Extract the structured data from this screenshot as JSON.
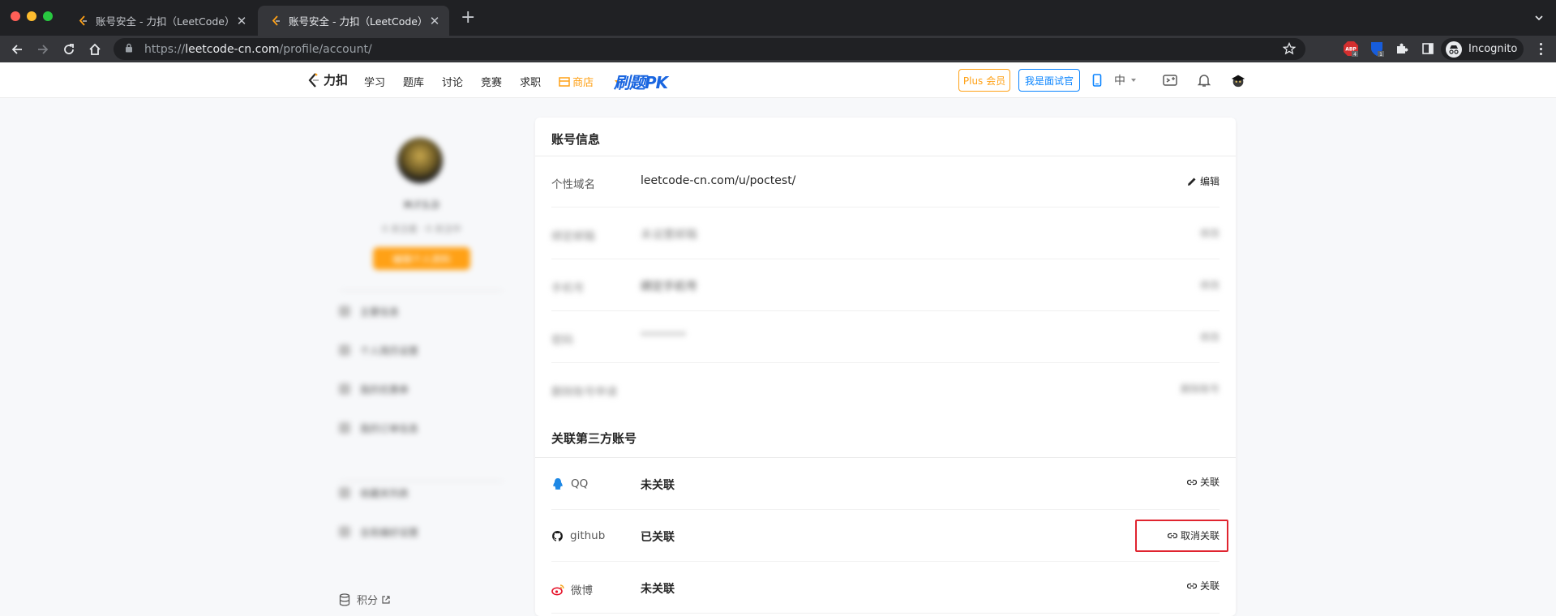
{
  "browser": {
    "tabs": [
      {
        "title": "账号安全 - 力扣（LeetCode）",
        "active": false
      },
      {
        "title": "账号安全 - 力扣（LeetCode）",
        "active": true
      }
    ],
    "url_host": "leetcode-cn.com",
    "url_prefix": "https://",
    "url_path": "/profile/account/",
    "profile_label": "Incognito",
    "extensions": [
      {
        "name": "adblock-icon",
        "badge": "4"
      },
      {
        "name": "bitwarden-icon",
        "badge": "1"
      },
      {
        "name": "puzzle-icon"
      },
      {
        "name": "sidepanel-icon"
      }
    ]
  },
  "site_nav": {
    "logo_text": "力扣",
    "links": [
      "学习",
      "题库",
      "讨论",
      "竞赛",
      "求职"
    ],
    "shop_label": "商店",
    "pk_text": "刷题",
    "pk_suffix": "PK",
    "plus_button": "Plus 会员",
    "interviewer_button": "我是面试官",
    "lang_label": "中"
  },
  "sidebar": {
    "name": "M.F.S.D",
    "subtitle": "0 关注者 · 0 关注中",
    "button_label": "编辑个人资料",
    "items": [
      "主要信息",
      "个人简历设置",
      "我的优惠券",
      "我的订单信息",
      "收藏夹列表",
      "全局偏好设置"
    ],
    "points_label": "积分"
  },
  "account_info": {
    "title": "账号信息",
    "rows": [
      {
        "label": "个性域名",
        "value": "leetcode-cn.com/u/poctest/",
        "action": "编辑",
        "blurred": false
      },
      {
        "label": "绑定邮箱",
        "value": "未设置邮箱",
        "action": "修改",
        "blurred": true
      },
      {
        "label": "手机号",
        "value": "绑定手机号",
        "action": "修改",
        "blurred": true
      },
      {
        "label": "密码",
        "value": "********",
        "action": "修改",
        "blurred": true
      },
      {
        "label": "删除账号申请",
        "value": "",
        "action": "删除账号",
        "blurred": true
      }
    ]
  },
  "third_party": {
    "title": "关联第三方账号",
    "rows": [
      {
        "name": "QQ",
        "icon": "qq-icon",
        "status": "未关联",
        "action": "关联",
        "color": "#1e88e5"
      },
      {
        "name": "github",
        "icon": "github-icon",
        "status": "已关联",
        "action": "取消关联",
        "color": "#1a1a1a"
      },
      {
        "name": "微博",
        "icon": "weibo-icon",
        "status": "未关联",
        "action": "关联",
        "color": "#e6162d"
      }
    ]
  },
  "colors": {
    "brand_orange": "#ffa116",
    "link_blue": "#0a84ff",
    "highlight_red": "#e0242f"
  }
}
